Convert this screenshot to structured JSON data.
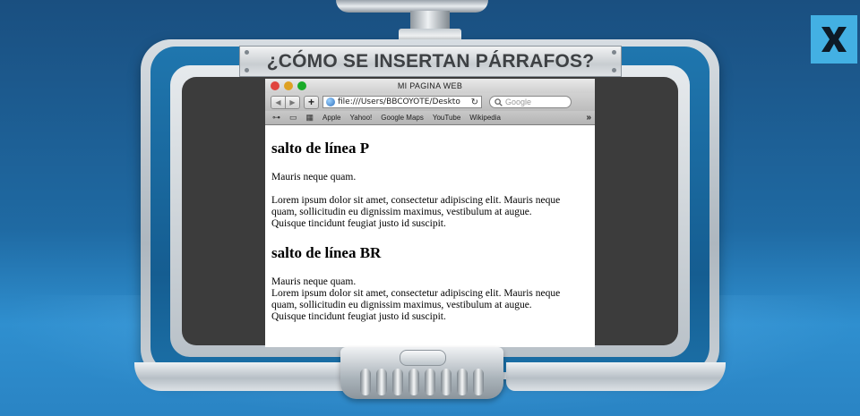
{
  "app": {
    "title": "¿CÓMO SE INSERTAN PÁRRAFOS?",
    "close_label": "X"
  },
  "browser": {
    "window_title": "MI PAGINA WEB",
    "address": "file:///Users/BBCOYOTE/Deskto",
    "search_placeholder": "Google",
    "bookmarks": [
      "Apple",
      "Yahoo!",
      "Google Maps",
      "YouTube",
      "Wikipedia"
    ],
    "more_label": "»"
  },
  "page": {
    "heading_p": "salto de línea P",
    "p1": "Mauris neque quam.",
    "p2_line1": "Lorem ipsum dolor sit amet, consectetur adipiscing elit. Mauris neque",
    "p2_line2": "quam, sollicitudin eu dignissim maximus, vestibulum at augue.",
    "p2_line3": "Quisque tincidunt feugiat justo id suscipit.",
    "heading_br": "salto de línea BR",
    "br_line1": "Mauris neque quam.",
    "br_line2": "Lorem ipsum dolor sit amet, consectetur adipiscing elit. Mauris neque",
    "br_line3": "quam, sollicitudin eu dignissim maximus, vestibulum at augue.",
    "br_line4": "Quisque tincidunt feugiat justo id suscipit."
  },
  "colors": {
    "background": "#1f6aa3",
    "close_button": "#43b0e3",
    "traffic_red": "#e0443e",
    "traffic_yellow": "#dea123",
    "traffic_green": "#1aab29"
  },
  "icons": [
    "close-icon",
    "back-icon",
    "forward-icon",
    "add-icon",
    "globe-icon",
    "reload-icon",
    "search-icon",
    "reader-icon",
    "book-icon",
    "grid-icon"
  ]
}
